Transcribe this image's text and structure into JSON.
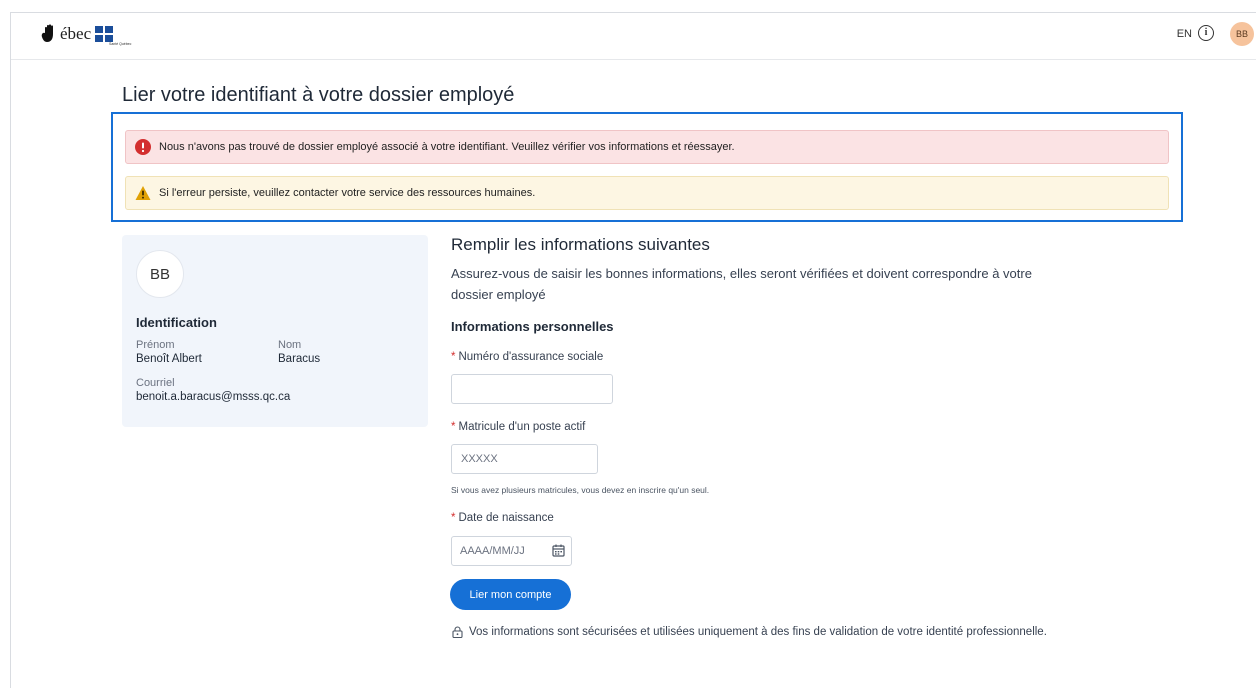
{
  "header": {
    "logo_text": "ébec",
    "logo_subtitle": "Santé Québec",
    "language_label": "EN",
    "info_glyph": "i",
    "user_initials": "BB"
  },
  "page": {
    "title": "Lier votre identifiant à votre dossier employé"
  },
  "alerts": {
    "error_text": "Nous n'avons pas trouvé de dossier employé associé à votre identifiant.  Veuillez vérifier vos informations et réessayer.",
    "warning_text": "Si l'erreur persiste, veuillez contacter votre service des ressources humaines.",
    "error_color": "#d32f2f",
    "warning_color": "#e0a106"
  },
  "profile": {
    "initials": "BB",
    "section_title": "Identification",
    "first_name_label": "Prénom",
    "first_name": "Benoît Albert",
    "last_name_label": "Nom",
    "last_name": "Baracus",
    "email_label": "Courriel",
    "email": "benoit.a.baracus@msss.qc.ca"
  },
  "form": {
    "title": "Remplir les informations suivantes",
    "description": "Assurez-vous de saisir les bonnes informations, elles seront vérifiées et doivent correspondre à votre dossier employé",
    "section_title": "Informations personnelles",
    "required_marker": "*",
    "sin_label": "Numéro d'assurance sociale",
    "sin_value": "",
    "employee_id_label": "Matricule d'un poste actif",
    "employee_id_placeholder": "XXXXX",
    "employee_id_hint": "Si vous avez plusieurs matricules, vous devez en inscrire qu'un seul.",
    "birthdate_label": "Date de naissance",
    "birthdate_placeholder": "AAAA/MM/JJ",
    "submit_label": "Lier mon compte",
    "security_note": "Vos informations sont sécurisées et utilisées uniquement à des fins de validation de votre identité professionnelle."
  },
  "colors": {
    "primary": "#1670d6",
    "card_background": "#f1f5fb",
    "avatar_background": "#f6c39c"
  }
}
